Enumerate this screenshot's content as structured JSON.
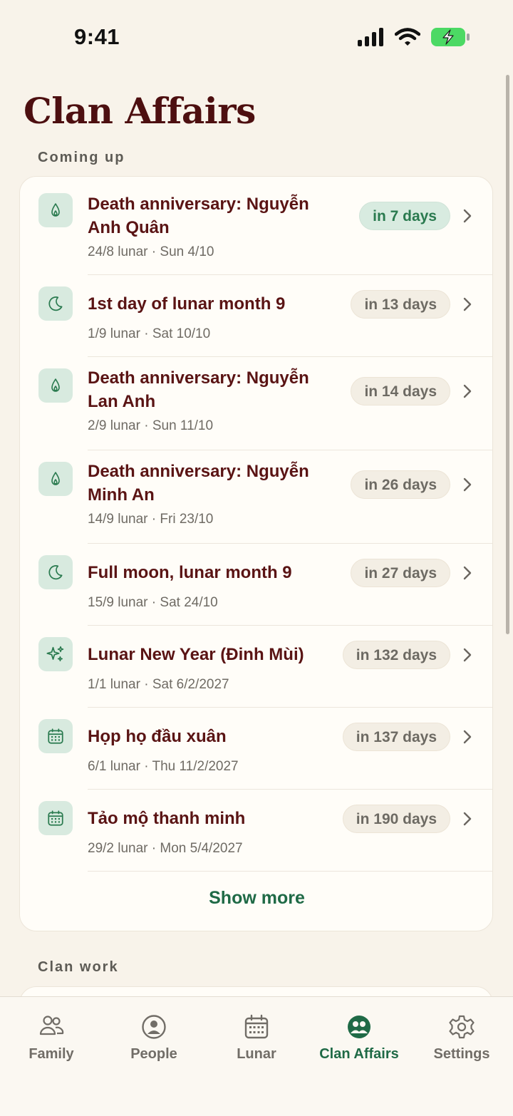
{
  "status_bar": {
    "time": "9:41"
  },
  "page": {
    "title": "Clan Affairs"
  },
  "sections": {
    "coming_up": "Coming up",
    "clan_work": "Clan work"
  },
  "events": [
    {
      "icon": "incense-flame-icon",
      "title": "Death anniversary: Nguyễn Anh Quân",
      "sub": "24/8 lunar · Sun 4/10",
      "badge": "in 7 days"
    },
    {
      "icon": "moon-icon",
      "title": "1st day of lunar month 9",
      "sub": "1/9 lunar · Sat 10/10",
      "badge": "in 13 days"
    },
    {
      "icon": "incense-flame-icon",
      "title": "Death anniversary: Nguyễn Lan Anh",
      "sub": "2/9 lunar · Sun 11/10",
      "badge": "in 14 days"
    },
    {
      "icon": "incense-flame-icon",
      "title": "Death anniversary: Nguyễn Minh An",
      "sub": "14/9 lunar · Fri 23/10",
      "badge": "in 26 days"
    },
    {
      "icon": "moon-icon",
      "title": "Full moon, lunar month 9",
      "sub": "15/9 lunar · Sat 24/10",
      "badge": "in 27 days"
    },
    {
      "icon": "sparkles-icon",
      "title": "Lunar New Year (Đinh Mùi)",
      "sub": "1/1 lunar · Sat 6/2/2027",
      "badge": "in 132 days"
    },
    {
      "icon": "calendar-icon",
      "title": "Họp họ đầu xuân",
      "sub": "6/1 lunar · Thu 11/2/2027",
      "badge": "in 137 days"
    },
    {
      "icon": "calendar-icon",
      "title": "Tảo mộ thanh minh",
      "sub": "29/2 lunar · Mon 5/4/2027",
      "badge": "in 190 days"
    }
  ],
  "show_more": "Show more",
  "tabs": [
    {
      "label": "Family",
      "icon": "family-icon"
    },
    {
      "label": "People",
      "icon": "person-icon"
    },
    {
      "label": "Lunar",
      "icon": "calendar-icon"
    },
    {
      "label": "Clan Affairs",
      "icon": "clan-icon",
      "active": true
    },
    {
      "label": "Settings",
      "icon": "gear-icon"
    }
  ],
  "colors": {
    "accent": "#1f6a46",
    "title": "#4d0f10",
    "background": "#f8f3ea"
  }
}
